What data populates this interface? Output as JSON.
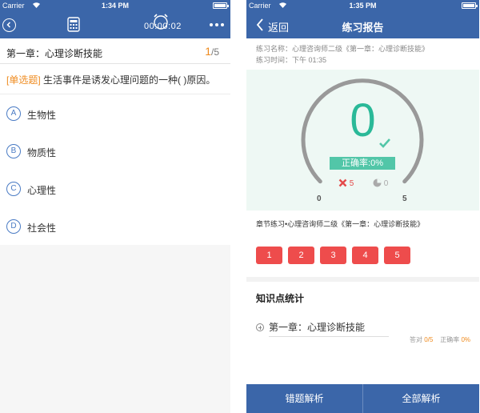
{
  "left": {
    "status": {
      "carrier": "Carrier",
      "time": "1:34 PM"
    },
    "navbar": {
      "timer": "00:00:02"
    },
    "chapter": {
      "title": "第一章：心理诊断技能",
      "current": "1",
      "total": "/5"
    },
    "question": {
      "type": "[单选题]",
      "text": "生活事件是诱发心理问题的一种(    )原因。"
    },
    "options": [
      {
        "letter": "A",
        "text": "生物性"
      },
      {
        "letter": "B",
        "text": "物质性"
      },
      {
        "letter": "C",
        "text": "心理性"
      },
      {
        "letter": "D",
        "text": "社会性"
      }
    ]
  },
  "right": {
    "status": {
      "carrier": "Carrier",
      "time": "1:35 PM"
    },
    "navbar": {
      "back": "返回",
      "title": "练习报告"
    },
    "meta": {
      "name": "练习名称：心理咨询师二级《第一章：心理诊断技能》",
      "time": "练习时间：下午 01:35"
    },
    "gauge": {
      "score": "0",
      "accuracy": "正确率:0%",
      "wrong_count": "5",
      "undone_count": "0",
      "min": "0",
      "max": "5",
      "fill_fraction": 0,
      "color": "#2ab998"
    },
    "practice_name": "章节练习•心理咨询师二级《第一章：心理诊断技能》",
    "question_buttons": [
      "1",
      "2",
      "3",
      "4",
      "5"
    ],
    "knowledge": {
      "title": "知识点统计",
      "items": [
        {
          "name": "第一章：心理诊断技能",
          "answered_label": "答对",
          "answered": "0/5",
          "rate_label": "正确率",
          "rate": "0%"
        }
      ]
    },
    "bottom": {
      "wrong_analysis": "错题解析",
      "all_analysis": "全部解析"
    }
  }
}
